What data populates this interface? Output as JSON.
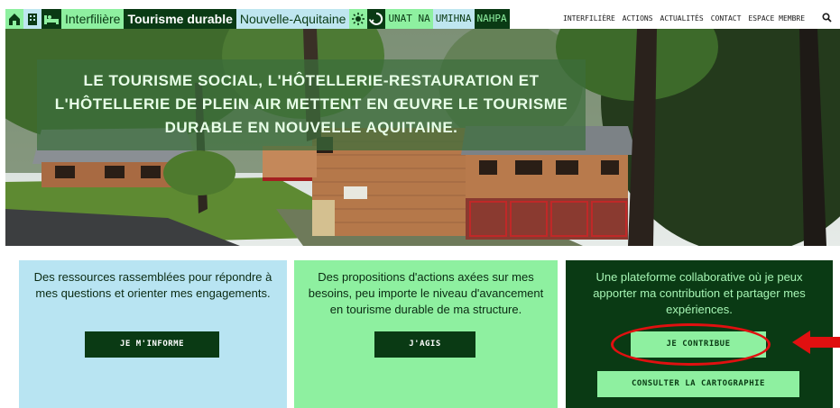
{
  "header": {
    "brand": {
      "word1": "Interfilière",
      "word2": "Tourisme durable",
      "word3": "Nouvelle-Aquitaine",
      "badges": [
        "UNAT NA",
        "UMIHNA",
        "NAHPA"
      ]
    },
    "nav": [
      "INTERFILIÈRE",
      "ACTIONS",
      "ACTUALITÉS",
      "CONTACT",
      "ESPACE MEMBRE"
    ]
  },
  "hero": {
    "title_lines": [
      "LE TOURISME SOCIAL, L'HÔTELLERIE-RESTAURATION ET",
      "L'HÔTELLERIE DE PLEIN AIR METTENT EN ŒUVRE LE TOURISME",
      "DURABLE EN NOUVELLE AQUITAINE."
    ]
  },
  "cards": [
    {
      "text_lines": [
        "Des ressources rassemblées pour répondre à",
        "mes questions et orienter mes engagements."
      ],
      "button": "JE M'INFORME"
    },
    {
      "text_lines": [
        "Des propositions d'actions axées sur mes",
        "besoins, peu importe le niveau d'avancement",
        "en tourisme durable de ma structure."
      ],
      "button": "J'AGIS"
    },
    {
      "text_lines": [
        "Une plateforme collaborative où je peux",
        "apporter ma contribution et partager mes",
        "expériences."
      ],
      "button": "JE CONTRIBUE",
      "button2": "CONSULTER LA CARTOGRAPHIE"
    }
  ],
  "colors": {
    "dark_green": "#0a3a14",
    "light_green": "#8ef0a0",
    "light_blue": "#b8e4f2",
    "annotation_red": "#e01010"
  },
  "icons": [
    "house-icon",
    "building-icon",
    "bed-icon",
    "sun-icon",
    "recycle-icon",
    "search-icon"
  ]
}
